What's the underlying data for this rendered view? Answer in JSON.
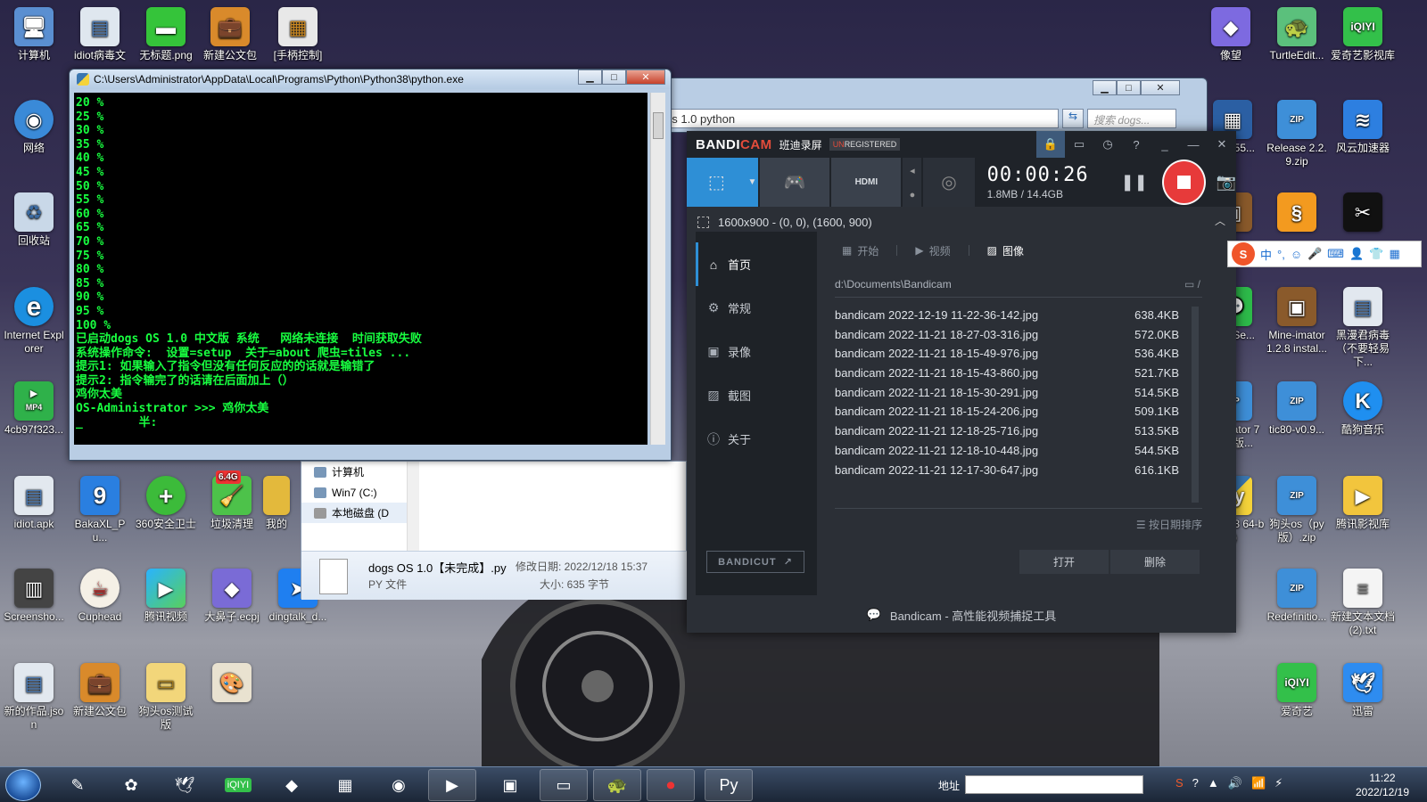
{
  "desktop_left": [
    {
      "label": "计算机",
      "x": 0,
      "y": 0
    },
    {
      "label": "idiot病毒文",
      "x": 0,
      "y": 0
    },
    {
      "label": "无标题.png",
      "x": 0,
      "y": 0
    },
    {
      "label": "新建公文包",
      "x": 0,
      "y": 0
    },
    {
      "label": "[手柄控制]",
      "x": 0,
      "y": 0
    }
  ],
  "icons": {
    "computer": "计算机",
    "idiot_virus": "idiot病毒文",
    "untitled_png": "无标题.png",
    "briefcase": "新建公文包",
    "gamepad_ctrl": "[手柄控制]",
    "network": "网络",
    "recycle": "回收站",
    "ie": "Internet Explorer",
    "mp4": "4cb97f323...",
    "mp4_badge": "MP4",
    "idiot_apk": "idiot.apk",
    "bakaxl": "BakaXL_Pu...",
    "s360": "360安全卫士",
    "junk": "垃圾清理",
    "junk_badge": "6.4G",
    "mine": "我的",
    "screenshot": "Screensho...",
    "cuphead": "Cuphead",
    "tencent_video": "腾讯视频",
    "dabizi": "大鼻子.ecpj",
    "dingtalk": "dingtalk_d...",
    "new_work": "新的作品.json",
    "briefcase2": "新建公文包",
    "goutou_test": "狗头os测试版",
    "xiangzheng": "像望",
    "turtle": "TurtleEdit...",
    "iqiyi_lib": "爱奇艺影视库",
    "n4655": "n_4655...",
    "release": "Release 2.2.9.zip",
    "fengyun": "风云加速器",
    "chatse": "ChatSe...",
    "mineimator": "Mine-imator 1.2.8 instal...",
    "heiman": "黑漫君病毒（不要轻易下...",
    "ie_mator": "ne-imator 7汉化版...",
    "tic80": "tic80-v0.9...",
    "kugou": "酷狗音乐",
    "python38": "thon 3.8 64-bit)",
    "goutou_zip": "狗头os（py版）.zip",
    "tencent_lib": "腾讯影视库",
    "redefinition": "Redefinitio...",
    "new_txt": "新建文本文档 (2).txt",
    "iqiyi": "爱奇艺",
    "xunlei": "迅雷"
  },
  "console": {
    "title": "C:\\Users\\Administrator\\AppData\\Local\\Programs\\Python\\Python38\\python.exe",
    "lines": [
      "20 %",
      "25 %",
      "30 %",
      "35 %",
      "40 %",
      "45 %",
      "50 %",
      "55 %",
      "60 %",
      "65 %",
      "70 %",
      "75 %",
      "80 %",
      "85 %",
      "90 %",
      "95 %",
      "100 %",
      "已启动dogs OS 1.0 中文版 系统   网络未连接  时间获取失败",
      "系统操作命令:  设置=setup  关于=about 爬虫=tiles ...",
      "提示1: 如果输入了指令但没有任何反应的的话就是输错了",
      "提示2: 指令输完了的话请在后面加上（）",
      "鸡你太美",
      "OS-Administrator >>> 鸡你太美",
      "",
      "_        半:"
    ],
    "min": "▁",
    "max": "□",
    "close": "✕"
  },
  "explorer_bg": {
    "address": "os 1.0 python",
    "search_placeholder": "搜索 dogs...",
    "min": "▁",
    "max": "□",
    "close": "✕"
  },
  "file_panel": {
    "tree": [
      "计算机",
      "Win7 (C:)",
      "本地磁盘 (D"
    ],
    "file_name": "dogs OS 1.0【未完成】.py",
    "file_type": "PY 文件",
    "modified": "修改日期: 2022/12/18 15:37",
    "size": "大小: 635 字节"
  },
  "bandicam": {
    "logo_a": "BANDI",
    "logo_b": "CAM",
    "cn_name": "班迪录屏",
    "unreg_a": "UN",
    "unreg_b": "REGISTERED",
    "timer": "00:00:26",
    "size": "1.8MB / 14.4GB",
    "hdmi": "HDMI",
    "region": "1600x900 - (0, 0), (1600, 900)",
    "sidebar": [
      "首页",
      "常规",
      "录像",
      "截图",
      "关于"
    ],
    "bandicut": "BANDICUT",
    "tabs": [
      "开始",
      "视频",
      "图像"
    ],
    "path": "d:\\Documents\\Bandicam",
    "files": [
      {
        "name": "bandicam 2022-12-19 11-22-36-142.jpg",
        "size": "638.4KB"
      },
      {
        "name": "bandicam 2022-11-21 18-27-03-316.jpg",
        "size": "572.0KB"
      },
      {
        "name": "bandicam 2022-11-21 18-15-49-976.jpg",
        "size": "536.4KB"
      },
      {
        "name": "bandicam 2022-11-21 18-15-43-860.jpg",
        "size": "521.7KB"
      },
      {
        "name": "bandicam 2022-11-21 18-15-30-291.jpg",
        "size": "514.5KB"
      },
      {
        "name": "bandicam 2022-11-21 18-15-24-206.jpg",
        "size": "509.1KB"
      },
      {
        "name": "bandicam 2022-11-21 12-18-25-716.jpg",
        "size": "513.5KB"
      },
      {
        "name": "bandicam 2022-11-21 12-18-10-448.jpg",
        "size": "544.5KB"
      },
      {
        "name": "bandicam 2022-11-21 12-17-30-647.jpg",
        "size": "616.1KB"
      }
    ],
    "sort": "按日期排序",
    "open": "打开",
    "delete": "删除",
    "footer": "Bandicam - 高性能视频捕捉工具"
  },
  "ime": {
    "logo": "S",
    "lang": "中",
    "punct": "°,"
  },
  "taskbar": {
    "address_label": "地址",
    "time": "11:22",
    "date": "2022/12/19"
  }
}
